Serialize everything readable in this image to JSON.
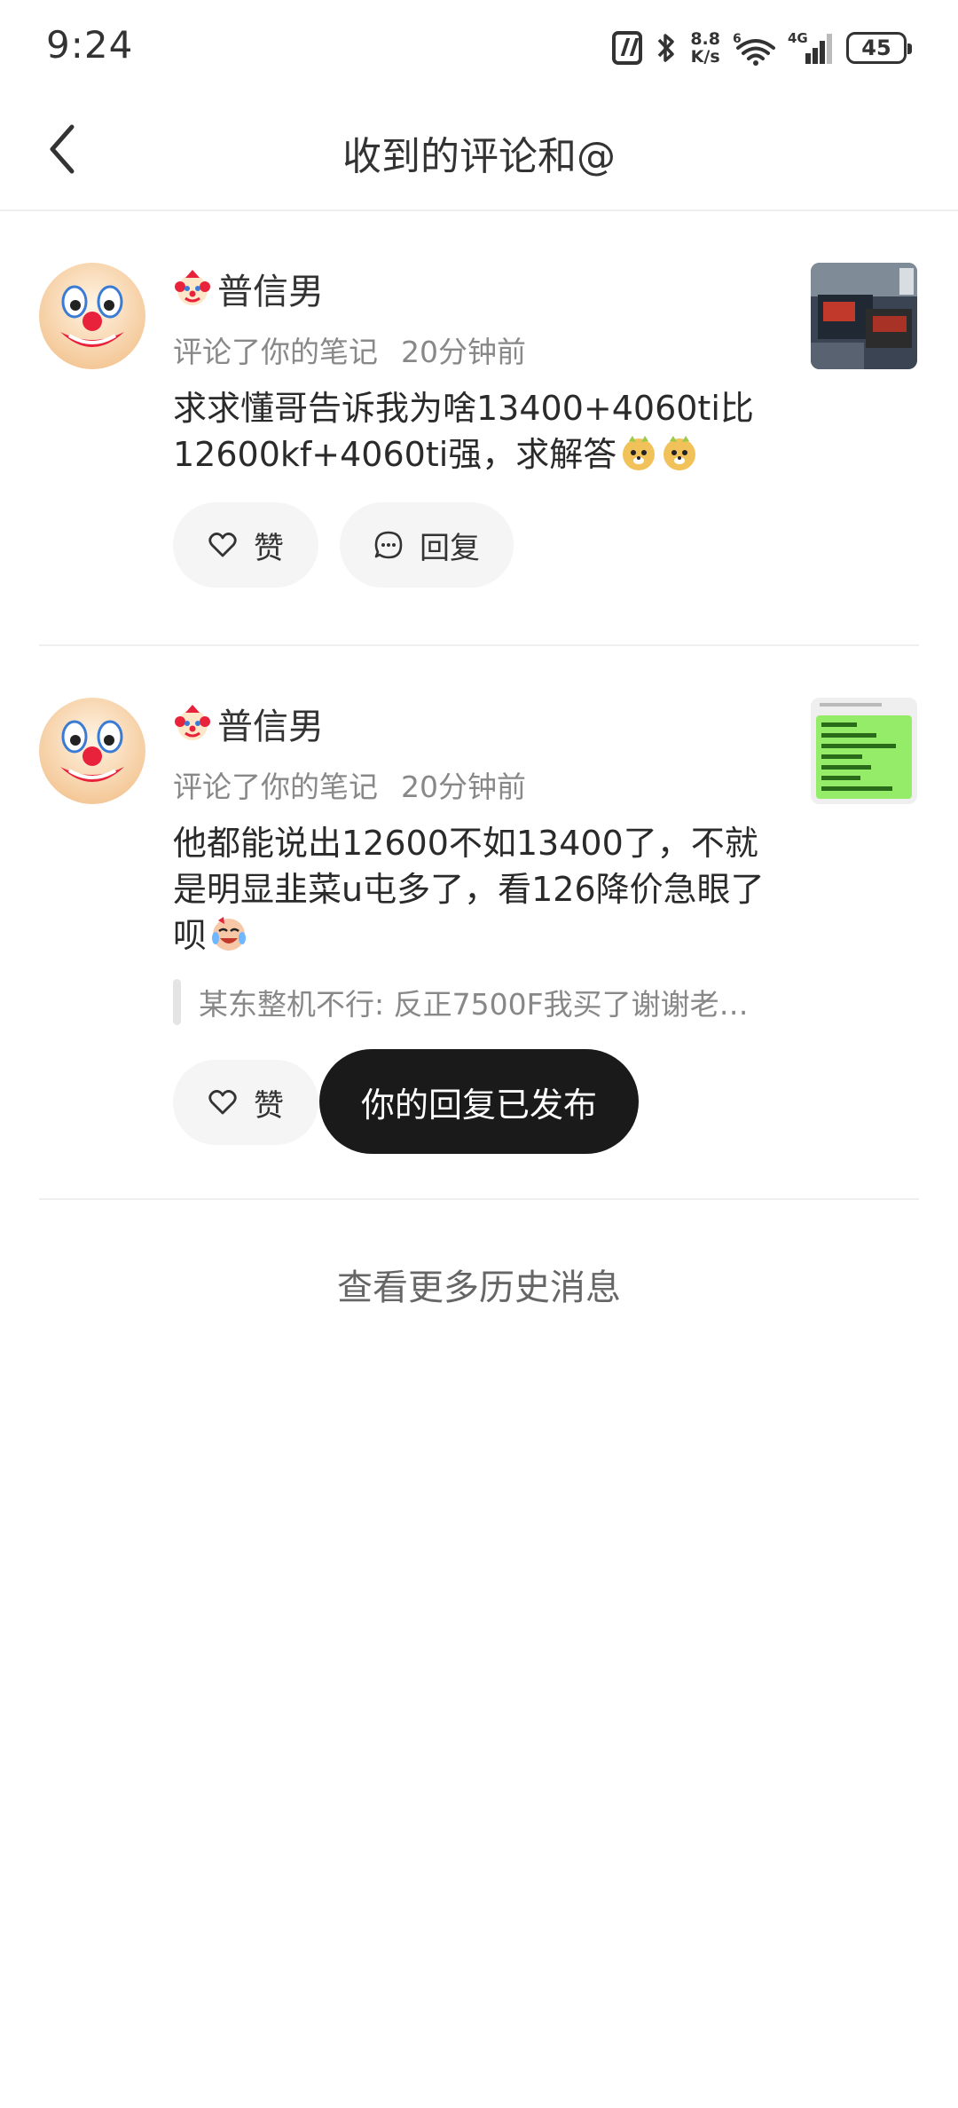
{
  "status_bar": {
    "time": "9:24",
    "speed_value": "8.8",
    "speed_unit": "K/s",
    "wifi_badge": "6",
    "network": "4G",
    "battery": "45"
  },
  "header": {
    "title": "收到的评论和@"
  },
  "notifications": [
    {
      "user_name": "普信男",
      "action": "评论了你的笔记",
      "time": "20分钟前",
      "comment": "求求懂哥告诉我为啥13400+4060ti比12600kf+4060ti强，求解答",
      "like_label": "赞",
      "reply_label": "回复"
    },
    {
      "user_name": "普信男",
      "action": "评论了你的笔记",
      "time": "20分钟前",
      "comment": "他都能说出12600不如13400了，不就是明显韭菜u屯多了，看126降价急眼了呗",
      "quote": "某东整机不行: 反正7500F我买了谢谢老…",
      "like_label": "赞"
    }
  ],
  "toast": "你的回复已发布",
  "more_history": "查看更多历史消息",
  "colors": {
    "toast_bg": "#1a1a1a",
    "button_bg": "#f5f5f5",
    "meta_text": "#888888"
  }
}
